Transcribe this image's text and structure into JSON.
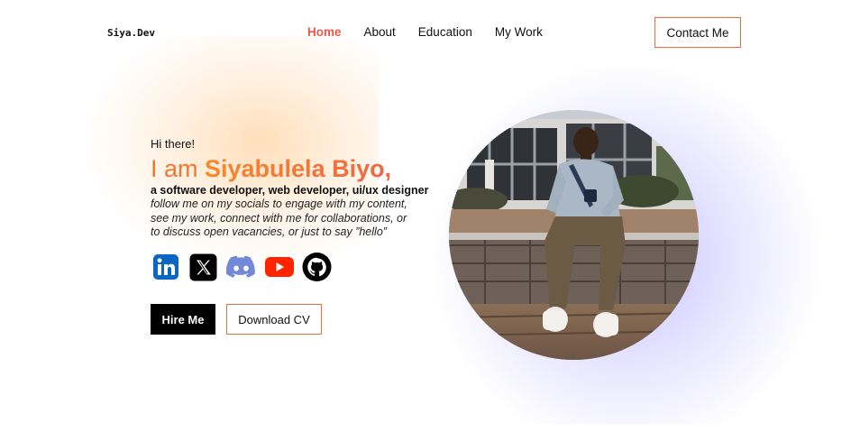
{
  "header": {
    "logo": "Siya.Dev",
    "nav": [
      {
        "label": "Home",
        "active": true
      },
      {
        "label": "About",
        "active": false
      },
      {
        "label": "Education",
        "active": false
      },
      {
        "label": "My Work",
        "active": false
      }
    ],
    "contact_label": "Contact Me"
  },
  "hero": {
    "greeting": "Hi there!",
    "headline_prefix": "I am ",
    "name": "Siyabulela Biyo",
    "headline_suffix": ",",
    "roles": "a software developer, web developer, ui/ux designer",
    "bio_lines": [
      "follow me on my socials to engage with my content,",
      "see my work, connect with me for collaborations, or",
      "to discuss open vacancies, or just to say ”hello”"
    ],
    "socials": [
      {
        "icon": "linkedin-icon",
        "color": "#0a66c2"
      },
      {
        "icon": "x-icon",
        "color": "#000000"
      },
      {
        "icon": "discord-icon",
        "color": "#7289da"
      },
      {
        "icon": "youtube-icon",
        "color": "#ff2400"
      },
      {
        "icon": "github-icon",
        "color": "#000000"
      }
    ],
    "hire_label": "Hire Me",
    "cv_label": "Download CV"
  },
  "colors": {
    "accent_orange": "#f4762e",
    "accent_red": "#f0574a",
    "glow_purple": "#9a8cff"
  }
}
